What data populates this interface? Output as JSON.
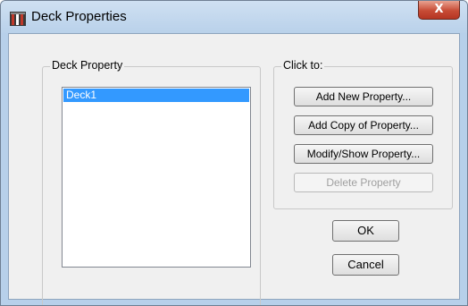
{
  "window": {
    "title": "Deck Properties",
    "close_symbol": "X"
  },
  "deck_property": {
    "group_label": "Deck Property",
    "items": [
      "Deck1"
    ],
    "selected": "Deck1"
  },
  "click_to": {
    "group_label": "Click to:",
    "buttons": {
      "add_new": "Add New Property...",
      "add_copy": "Add Copy of Property...",
      "modify_show": "Modify/Show Property...",
      "delete": "Delete Property"
    },
    "delete_enabled": false
  },
  "dialog_buttons": {
    "ok": "OK",
    "cancel": "Cancel"
  },
  "icons": {
    "app": "etabs-app-icon",
    "close": "close-icon"
  },
  "colors": {
    "selection": "#3399ff",
    "close_button": "#c74b35",
    "titlebar": "#b9d1ea"
  }
}
